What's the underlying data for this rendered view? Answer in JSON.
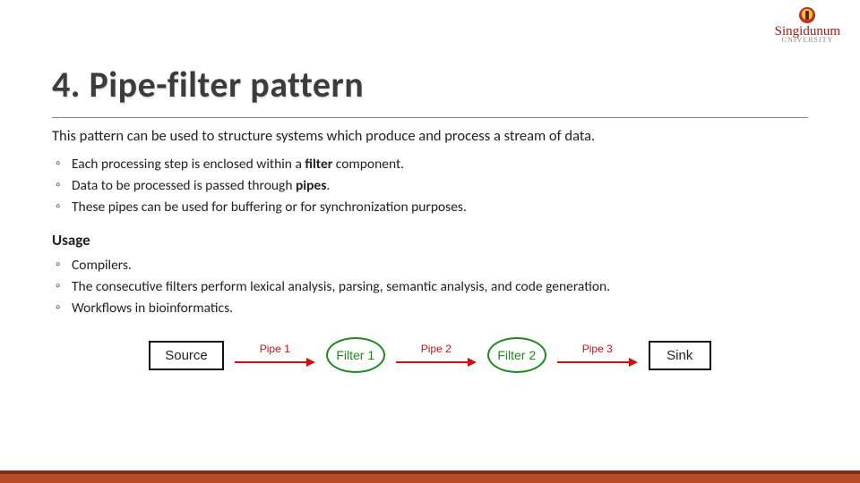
{
  "brand": {
    "name": "Singidunum",
    "sub": "UNIVERSITY"
  },
  "title": "4. Pipe-filter pattern",
  "lead": "This pattern can be used to structure systems which produce and process a stream of data.",
  "points1": {
    "a_pre": "Each processing step is enclosed within a ",
    "a_b": "filter",
    "a_post": " component.",
    "b_pre": "Data to be processed is passed through ",
    "b_b": "pipes",
    "b_post": ".",
    "c": "These pipes can be used for buffering or for synchronization purposes."
  },
  "usage_h": "Usage",
  "points2": {
    "a": "Compilers.",
    "b": "The consecutive filters perform lexical analysis, parsing, semantic analysis, and code generation.",
    "c": "Workflows in bioinformatics."
  },
  "diagram": {
    "source": "Source",
    "sink": "Sink",
    "filter1": "Filter 1",
    "filter2": "Filter 2",
    "pipe1": "Pipe 1",
    "pipe2": "Pipe 2",
    "pipe3": "Pipe 3"
  }
}
